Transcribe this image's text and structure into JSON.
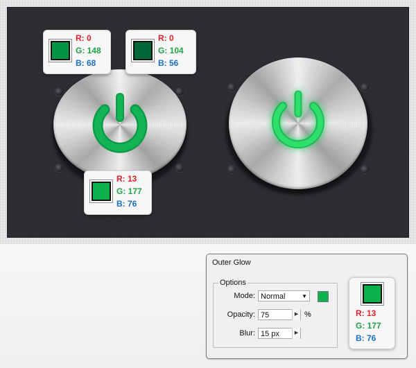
{
  "artboard": {
    "background": "#2b2b31",
    "knobs": [
      {
        "name": "knob-left",
        "glow": false
      },
      {
        "name": "knob-right",
        "glow": true
      }
    ]
  },
  "callouts": [
    {
      "name": "color-callout-1",
      "r": "R: 0",
      "g": "G: 148",
      "b": "B: 68",
      "swatch": "#009444"
    },
    {
      "name": "color-callout-2",
      "r": "R: 0",
      "g": "G: 104",
      "b": "B: 56",
      "swatch": "#006838"
    },
    {
      "name": "color-callout-3",
      "r": "R: 13",
      "g": "G: 177",
      "b": "B: 76",
      "swatch": "#0db14c"
    }
  ],
  "outer_glow": {
    "title": "Outer Glow",
    "options_label": "Options",
    "mode_label": "Mode:",
    "mode_value": "Normal",
    "opacity_label": "Opacity:",
    "opacity_value": "75",
    "opacity_unit": "%",
    "blur_label": "Blur:",
    "blur_value": "15 px",
    "glow_color": "#0db14c",
    "color_callout": {
      "r": "R: 13",
      "g": "G: 177",
      "b": "B: 76",
      "swatch": "#0db14c"
    }
  }
}
